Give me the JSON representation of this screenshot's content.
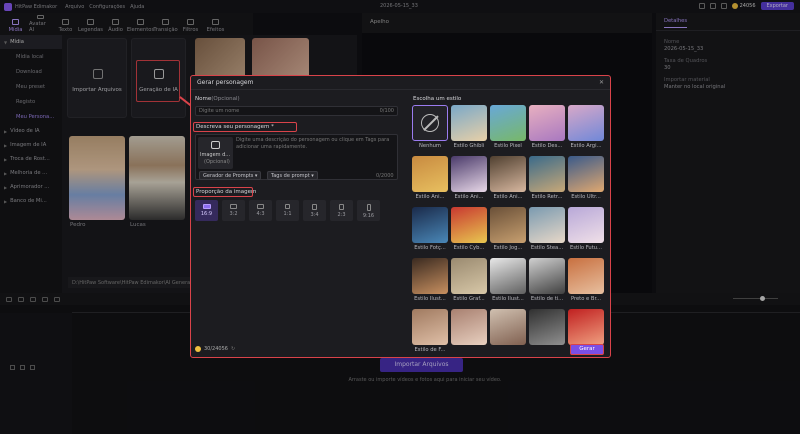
{
  "app": {
    "name": "HitPaw Edimakor",
    "menu": [
      "Arquivo",
      "Configurações",
      "Ajuda"
    ],
    "project_name": "2026-05-15_33",
    "coins": "24056",
    "upgrade_label": "Exportar"
  },
  "tabs": [
    {
      "label": "Mídia",
      "icon": "media-icon"
    },
    {
      "label": "Avatar AI",
      "icon": "avatar-icon"
    },
    {
      "label": "Texto",
      "icon": "text-icon"
    },
    {
      "label": "Legendas",
      "icon": "captions-icon"
    },
    {
      "label": "Áudio",
      "icon": "audio-icon"
    },
    {
      "label": "Elementos",
      "icon": "elements-icon"
    },
    {
      "label": "Transição",
      "icon": "transition-icon"
    },
    {
      "label": "Filtros",
      "icon": "filter-icon"
    },
    {
      "label": "Efeitos",
      "icon": "effects-icon"
    }
  ],
  "sidebar": {
    "header": "Mídia",
    "items": [
      "Mídia local",
      "Download",
      "Meu preset",
      "Registo",
      "Meu Persona..."
    ],
    "categories": [
      "Vídeo de IA",
      "Imagem de IA",
      "Troca de Rost...",
      "Melhoria de ...",
      "Aprimorador ...",
      "Banco de Mi..."
    ]
  },
  "library": {
    "import_label": "Importar Arquivos",
    "ai_gen_label": "Geração de IA",
    "thumbs": [
      "Pedro",
      "Lucas"
    ],
    "path": "D:\\HitPaw Software\\HitPaw Edimakor\\AI Generate..."
  },
  "preview": {
    "header": "Apelho"
  },
  "details": {
    "tab": "Detalhes",
    "fields": [
      {
        "label": "Nome",
        "value": "2026-05-15_33"
      },
      {
        "label": "Taxa de Quadros",
        "value": "30"
      },
      {
        "label": "Importar material",
        "value": "Manter no local original"
      }
    ]
  },
  "timeline": {
    "import_label": "Importar Arquivos",
    "hint": "Arraste ou importe vídeos e fotos aqui para iniciar seu vídeo."
  },
  "dialog": {
    "title": "Gerar personagem",
    "name_label": "Nome",
    "name_optional": "(Opcional)",
    "name_placeholder": "Digite um nome",
    "name_counter": "0/100",
    "describe_label": "Descreva seu personagem *",
    "image_label": "Imagem d...",
    "image_optional": "(Opcional)",
    "describe_placeholder": "Digite uma descrição do personagem ou clique em Tags para adicionar uma rapidamente.",
    "prompt_gen": "Gerador de Prompts",
    "prompt_tags": "Tags de prompt",
    "desc_counter": "0/2000",
    "ratio_label": "Proporção da imagem",
    "ratios": [
      "16:9",
      "3:2",
      "4:3",
      "1:1",
      "3:4",
      "2:3",
      "9:16"
    ],
    "style_label": "Escolha um estilo",
    "styles": [
      "Nenhum",
      "Estilo Ghibli",
      "Estilo Pixel",
      "Estilo Des...",
      "Estilo Argi...",
      "Estilo Ani...",
      "Estilo Ani...",
      "Estilo Ani...",
      "Estilo Retr...",
      "Estilo Ultr...",
      "Estilo Fotç...",
      "Estilo Cyb...",
      "Estilo Jog...",
      "Estilo Stea...",
      "Estilo Futu...",
      "Estilo Ilust...",
      "Estilo Graf...",
      "Estilo Ilust...",
      "Estilo de ti...",
      "Preto e Br...",
      "Estilo de F..."
    ],
    "coins": "30/24056",
    "generate_label": "Gerar"
  },
  "colors": {
    "accent": "#8b5cf6",
    "highlight": "#d9434a",
    "bg": "#111114"
  }
}
